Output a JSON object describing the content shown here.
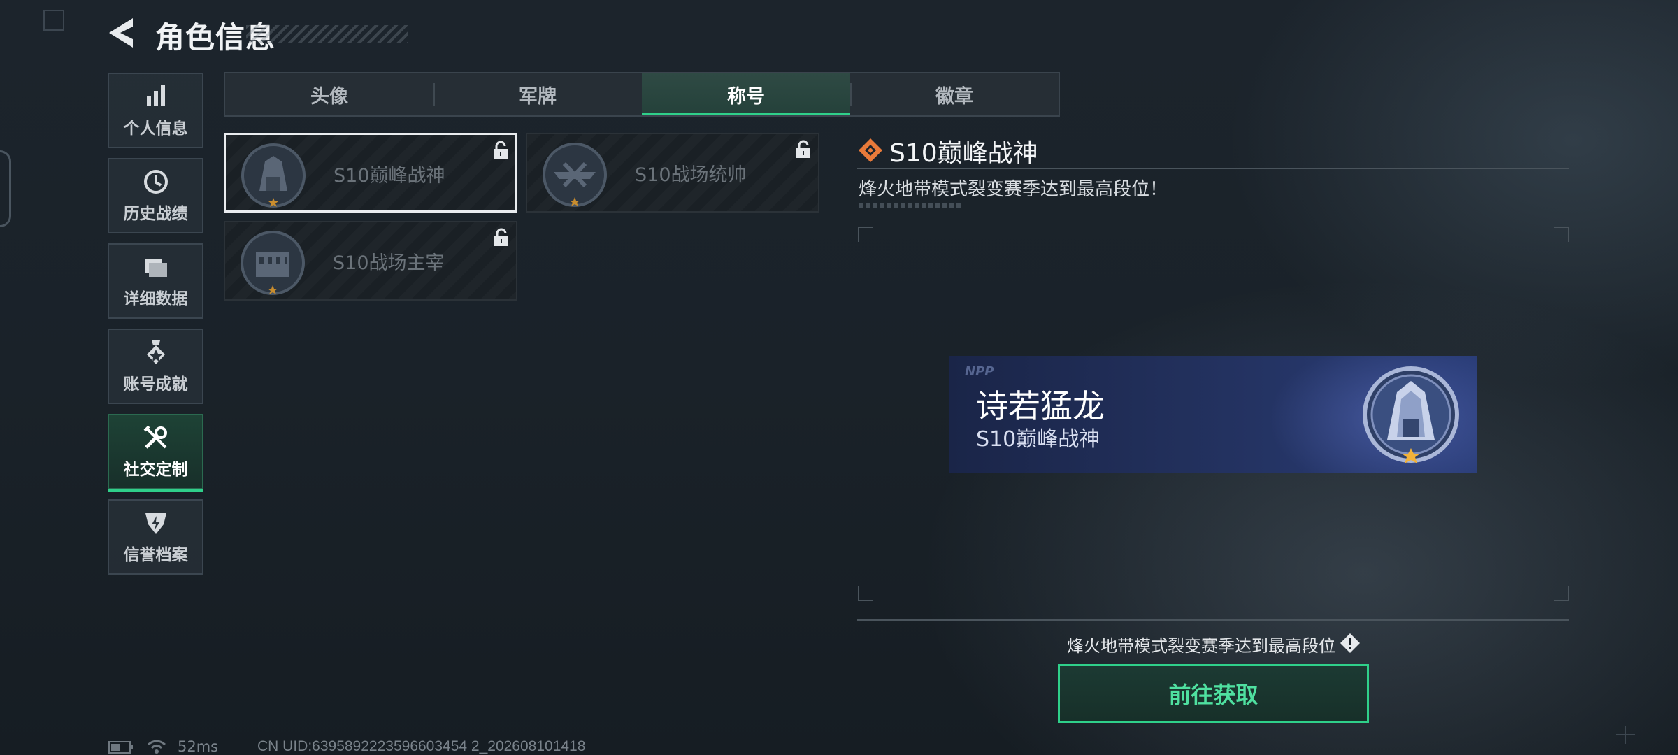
{
  "header": {
    "title": "角色信息"
  },
  "sidebar": {
    "items": [
      {
        "label": "个人信息",
        "icon": "bar-chart-icon",
        "active": false
      },
      {
        "label": "历史战绩",
        "icon": "clock-icon",
        "active": false
      },
      {
        "label": "详细数据",
        "icon": "folder-icon",
        "active": false
      },
      {
        "label": "账号成就",
        "icon": "medal-icon",
        "active": false
      },
      {
        "label": "社交定制",
        "icon": "tools-icon",
        "active": true
      },
      {
        "label": "信誉档案",
        "icon": "shield-icon",
        "active": false
      }
    ]
  },
  "tabs": [
    {
      "label": "头像",
      "active": false
    },
    {
      "label": "军牌",
      "active": false
    },
    {
      "label": "称号",
      "active": true
    },
    {
      "label": "徽章",
      "active": false
    }
  ],
  "titles": [
    {
      "name": "S10巅峰战神",
      "selected": true,
      "locked": true
    },
    {
      "name": "S10战场统帅",
      "selected": false,
      "locked": true
    },
    {
      "name": "S10战场主宰",
      "selected": false,
      "locked": true
    }
  ],
  "detail": {
    "title": "S10巅峰战神",
    "description": "烽火地带模式裂变赛季达到最高段位！"
  },
  "banner": {
    "watermark": "NPP",
    "nickname": "诗若猛龙",
    "title": "S10巅峰战神"
  },
  "requirement": {
    "text": "烽火地带模式裂变赛季达到最高段位"
  },
  "action": {
    "label": "前往获取"
  },
  "status": {
    "ping": "52ms",
    "uid": "CN UID:6395892223596603454 2_202608101418"
  },
  "colors": {
    "accent": "#2fd08a",
    "icon_orange": "#e87a3a",
    "banner_blue": "#22305c"
  }
}
